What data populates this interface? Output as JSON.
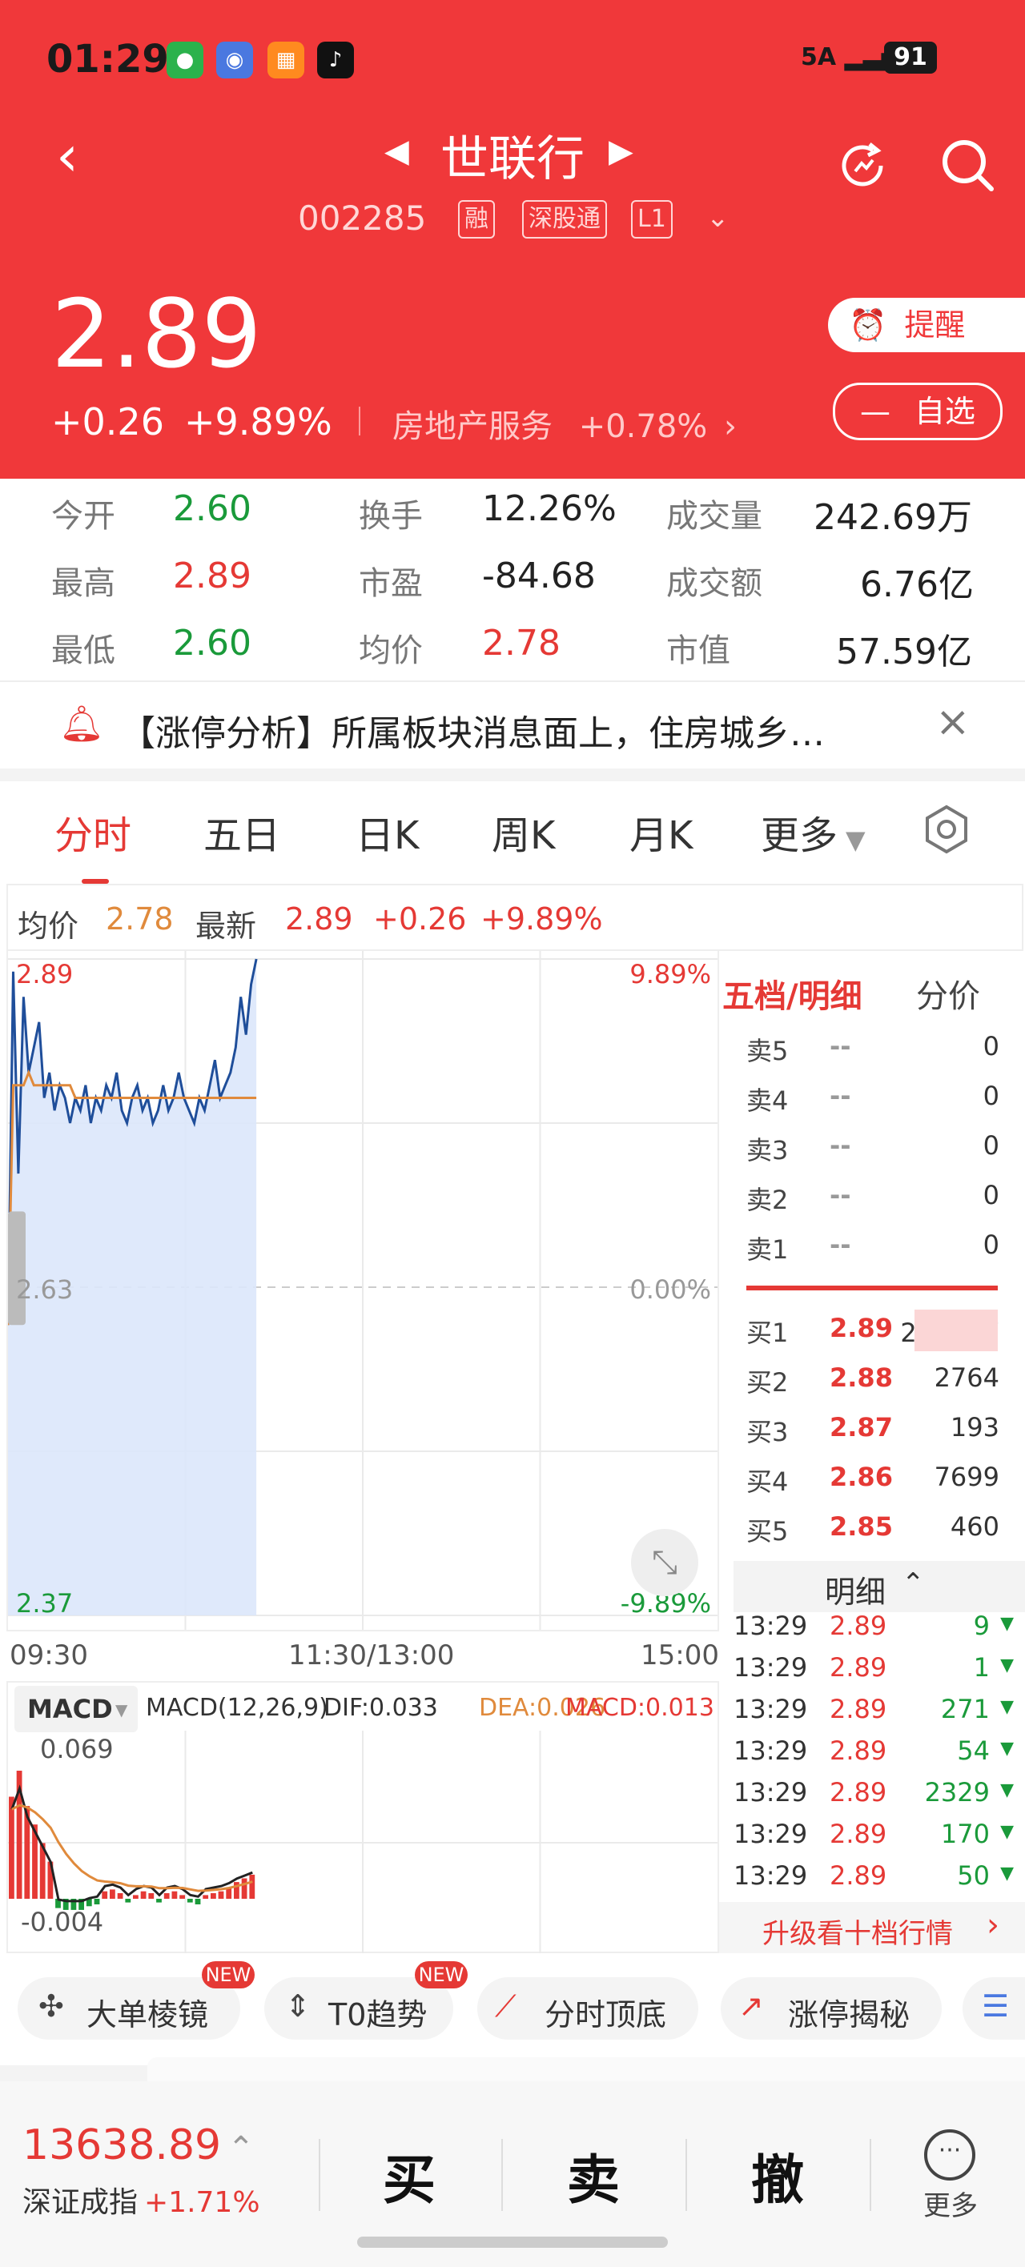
{
  "status": {
    "time": "01:29",
    "network": "5A",
    "battery": "91"
  },
  "header": {
    "title": "世联行",
    "code": "002285",
    "tags": [
      "融",
      "深股通",
      "L1"
    ],
    "price": "2.89",
    "change": "+0.26",
    "change_pct": "+9.89%",
    "sector": "房地产服务",
    "sector_pct": "+0.78%",
    "remind_label": "提醒",
    "watch_label": "自选",
    "prev_icon": "triangle-left-icon",
    "next_icon": "triangle-right-icon"
  },
  "stats": [
    {
      "label": "今开",
      "value": "2.60"
    },
    {
      "label": "换手",
      "value": "12.26%"
    },
    {
      "label": "成交量",
      "value": "242.69万"
    },
    {
      "label": "最高",
      "value": "2.89"
    },
    {
      "label": "市盈",
      "value": "-84.68"
    },
    {
      "label": "成交额",
      "value": "6.76亿"
    },
    {
      "label": "最低",
      "value": "2.60"
    },
    {
      "label": "均价",
      "value": "2.78"
    },
    {
      "label": "市值",
      "value": "57.59亿"
    }
  ],
  "notice": {
    "text": "【涨停分析】所属板块消息面上，住房城乡…"
  },
  "tabs": [
    "分时",
    "五日",
    "日K",
    "周K",
    "月K",
    "更多"
  ],
  "chart_info": {
    "avg_label": "均价",
    "avg_value": "2.78",
    "latest_label": "最新",
    "latest_value": "2.89",
    "latest_change": "+0.26",
    "latest_pct": "+9.89%"
  },
  "chart_data": [
    {
      "type": "line",
      "series": [
        {
          "values": [
            2.6,
            2.88,
            2.72,
            2.86,
            2.8,
            2.82,
            2.84,
            2.78,
            2.8,
            2.77,
            2.79,
            2.78,
            2.76,
            2.78,
            2.77,
            2.79,
            2.76,
            2.78,
            2.77,
            2.79,
            2.78,
            2.8,
            2.77,
            2.76,
            2.78,
            2.79,
            2.77,
            2.78,
            2.76,
            2.77,
            2.79,
            2.77,
            2.78,
            2.8,
            2.78,
            2.77,
            2.76,
            2.78,
            2.77,
            2.79,
            2.81,
            2.78,
            2.79,
            2.8,
            2.82,
            2.86,
            2.83,
            2.87,
            2.89
          ]
        },
        {
          "values": [
            2.6,
            2.79,
            2.79,
            2.79,
            2.8,
            2.79,
            2.79,
            2.79,
            2.79,
            2.79,
            2.79,
            2.79,
            2.79,
            2.78,
            2.78,
            2.78,
            2.78,
            2.78,
            2.78,
            2.78,
            2.78,
            2.78,
            2.78,
            2.78,
            2.78,
            2.78,
            2.78,
            2.78,
            2.78,
            2.78,
            2.78,
            2.78,
            2.78,
            2.78,
            2.78,
            2.78,
            2.78,
            2.78,
            2.78,
            2.78,
            2.78,
            2.78,
            2.78,
            2.78,
            2.78,
            2.78,
            2.78,
            2.78,
            2.78
          ]
        }
      ],
      "ylim": [
        2.37,
        2.89
      ],
      "y_labels_left": [
        "2.89",
        "2.63",
        "2.37"
      ],
      "y_labels_right": [
        "9.89%",
        "0.00%",
        "-9.89%"
      ],
      "x_labels": [
        "09:30",
        "11:30/13:00",
        "15:00"
      ]
    },
    {
      "type": "bar",
      "title": "MACD",
      "params": "MACD(12,26,9)",
      "dif": "DIF:0.033",
      "dea": "DEA:0.026",
      "macd": "MACD:0.013",
      "y_labels": [
        "0.069",
        "-0.004"
      ],
      "values": [
        0.055,
        0.069,
        0.05,
        0.04,
        0.03,
        0.02,
        -0.005,
        -0.006,
        -0.006,
        -0.006,
        -0.004,
        -0.003,
        0.004,
        0.005,
        0.003,
        -0.002,
        0.002,
        0.004,
        0.003,
        -0.002,
        0.003,
        0.004,
        0.002,
        -0.002,
        -0.003,
        0.002,
        0.003,
        0.004,
        0.006,
        0.009,
        0.011,
        0.013
      ]
    }
  ],
  "orderbook": {
    "tab_active": "五档/明细",
    "tab_other": "分价",
    "sell": [
      {
        "label": "卖5",
        "price": "--",
        "vol": "0"
      },
      {
        "label": "卖4",
        "price": "--",
        "vol": "0"
      },
      {
        "label": "卖3",
        "price": "--",
        "vol": "0"
      },
      {
        "label": "卖2",
        "price": "--",
        "vol": "0"
      },
      {
        "label": "卖1",
        "price": "--",
        "vol": "0"
      }
    ],
    "buy": [
      {
        "label": "买1",
        "price": "2.89",
        "vol": "29.37万"
      },
      {
        "label": "买2",
        "price": "2.88",
        "vol": "2764"
      },
      {
        "label": "买3",
        "price": "2.87",
        "vol": "193"
      },
      {
        "label": "买4",
        "price": "2.86",
        "vol": "7699"
      },
      {
        "label": "买5",
        "price": "2.85",
        "vol": "460"
      }
    ],
    "detail_label": "明细",
    "details": [
      {
        "time": "13:29",
        "price": "2.89",
        "vol": "9"
      },
      {
        "time": "13:29",
        "price": "2.89",
        "vol": "1"
      },
      {
        "time": "13:29",
        "price": "2.89",
        "vol": "271"
      },
      {
        "time": "13:29",
        "price": "2.89",
        "vol": "54"
      },
      {
        "time": "13:29",
        "price": "2.89",
        "vol": "2329"
      },
      {
        "time": "13:29",
        "price": "2.89",
        "vol": "170"
      },
      {
        "time": "13:29",
        "price": "2.89",
        "vol": "50"
      }
    ],
    "upgrade": "升级看十档行情"
  },
  "tools": [
    {
      "label": "大单棱镜",
      "badge": "NEW"
    },
    {
      "label": "T0趋势",
      "badge": "NEW"
    },
    {
      "label": "分时顶底",
      "badge": ""
    },
    {
      "label": "涨停揭秘",
      "badge": ""
    }
  ],
  "bottom": {
    "index_value": "13638.89",
    "index_name": "深证成指",
    "index_pct": "+1.71%",
    "buy": "买",
    "sell": "卖",
    "cancel": "撤",
    "more": "更多"
  },
  "colors": {
    "brand": "#f0383a",
    "up": "#e53935",
    "down": "#1a9a3a",
    "avg_line": "#e08a3c",
    "price_line": "#1f4e9a"
  }
}
